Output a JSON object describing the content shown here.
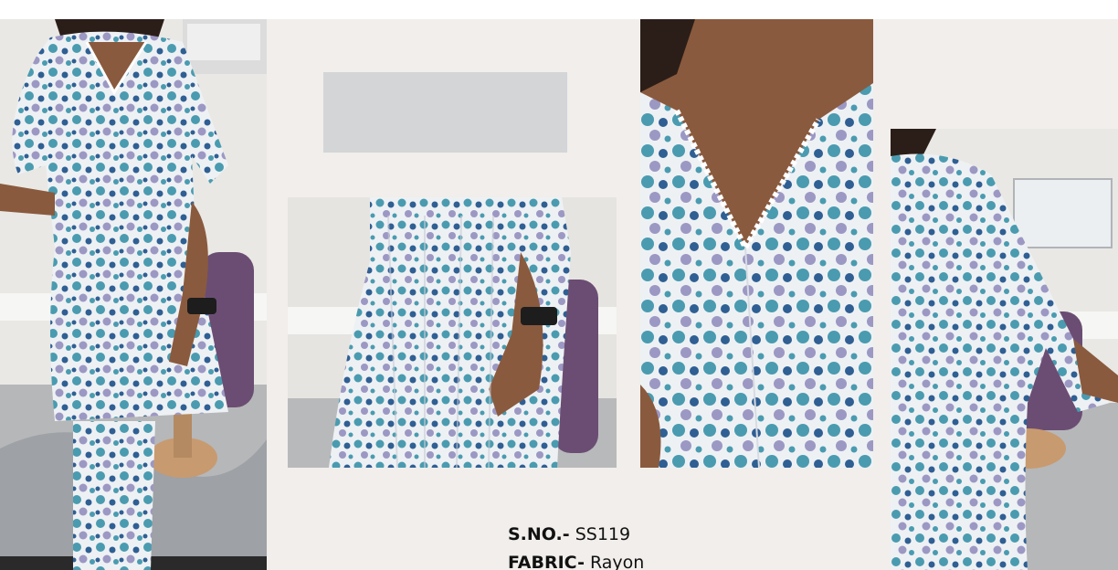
{
  "product": {
    "sno_label": "S.NO.-",
    "sno_value": "SS119",
    "fabric_label": "FABRIC-",
    "fabric_value": "Rayon"
  },
  "images": [
    {
      "name": "model-full-front-photo",
      "description_icon": "photo-icon"
    },
    {
      "name": "skirt-closeup-photo",
      "description_icon": "photo-icon"
    },
    {
      "name": "neckline-closeup-photo",
      "description_icon": "photo-icon"
    },
    {
      "name": "model-side-photo",
      "description_icon": "photo-icon"
    }
  ],
  "colors": {
    "page_background": "#f1eeeb",
    "placeholder_block": "#d3d5d7",
    "fabric_white": "#eef1f4",
    "fabric_teal": "#4a9bb0",
    "fabric_blue": "#2f5f93",
    "fabric_lavender": "#9c98c4",
    "chair_purple": "#6b4d73",
    "stool_gold": "#c89a6f",
    "skin": "#8a5a3e",
    "hair": "#2b1e18",
    "wall": "#e9e8e4"
  }
}
